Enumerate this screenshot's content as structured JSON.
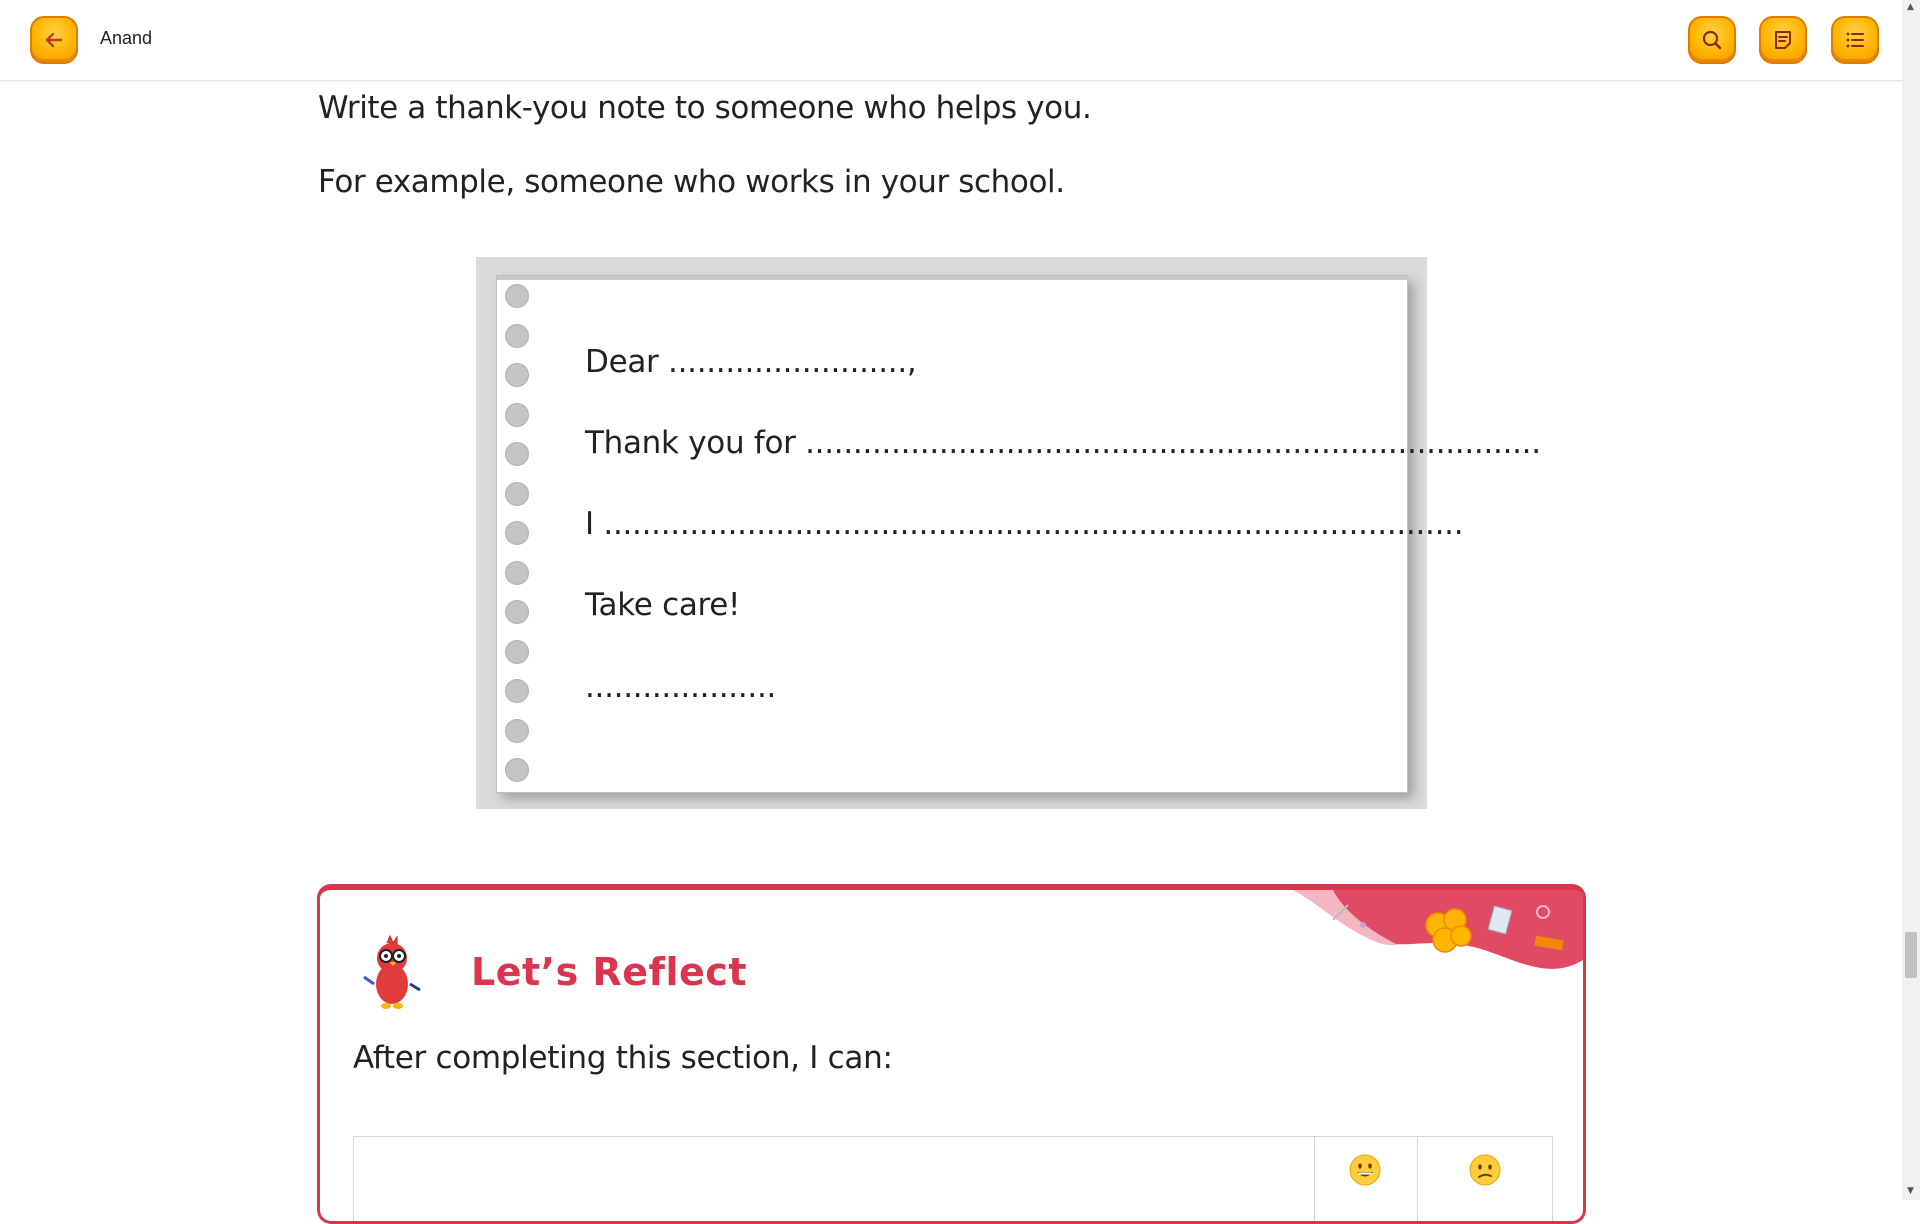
{
  "header": {
    "user_name": "Anand",
    "back_icon": "arrow-left-icon",
    "actions": [
      "search-icon",
      "notes-icon",
      "menu-list-icon"
    ]
  },
  "content": {
    "instruction": "Write a thank-you note to someone who helps you.",
    "example": "For example, someone who works in your school."
  },
  "note": {
    "lines": [
      "Dear .........................,",
      "Thank you for .............................................................................",
      "I ..........................................................................................",
      "Take care!",
      "...................."
    ]
  },
  "reflect": {
    "title": "Let’s Reflect",
    "subtitle": "After completing this section, I can:",
    "columns": [
      "grinning-face-emoji",
      "confused-face-emoji"
    ]
  },
  "colors": {
    "accent": "#ffb400",
    "reflect_red": "#d9364e"
  }
}
